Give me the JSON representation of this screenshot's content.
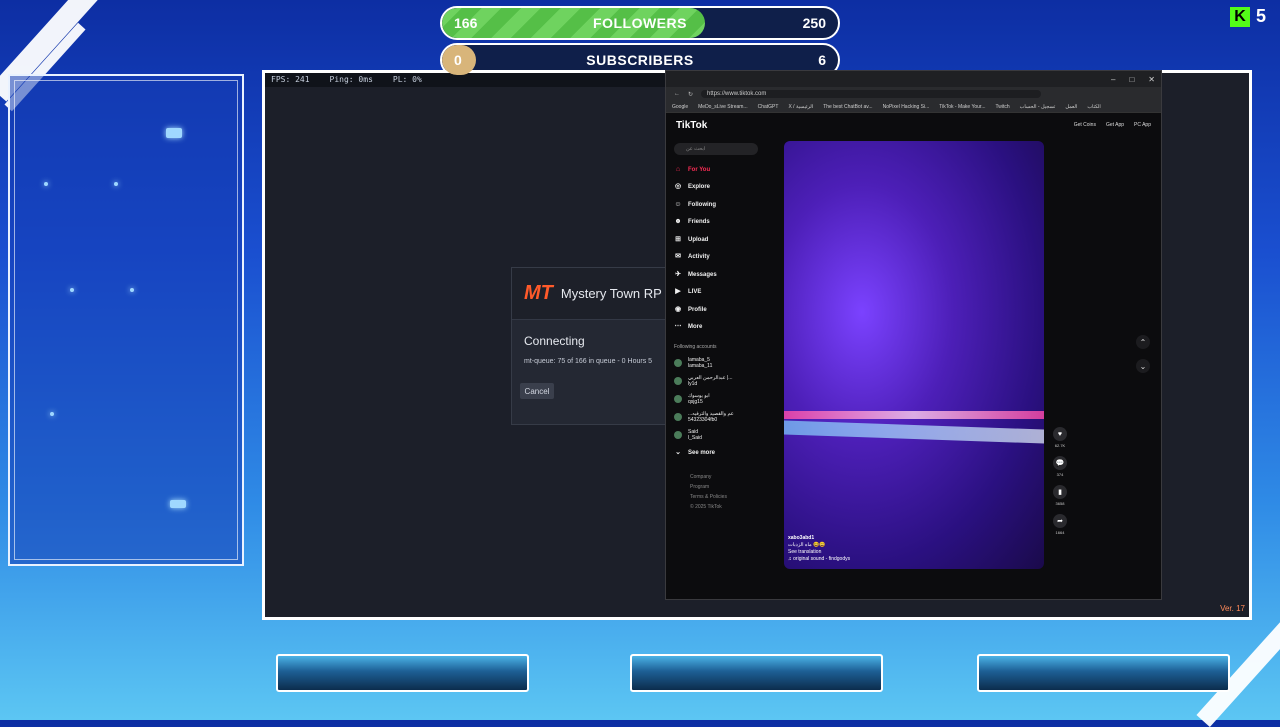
{
  "overlay": {
    "followers": {
      "label": "FOLLOWERS",
      "current": "166",
      "goal": "250",
      "progress": 0.664
    },
    "subscribers": {
      "label": "SUBSCRIBERS",
      "current": "0",
      "goal": "6",
      "progress": 0.0
    },
    "kick": {
      "icon": "kick-logo",
      "viewer_count": "5"
    }
  },
  "game": {
    "perf": {
      "fps": "FPS: 241",
      "ping": "Ping: 0ms",
      "pl": "PL: 0%"
    },
    "dialog": {
      "logo": "MT",
      "server_name": "Mystery Town RP",
      "status": "Connecting",
      "queue": "mt-queue: 75 of 166 in queue - 0 Hours 5",
      "cancel_label": "Cancel"
    },
    "version": "Ver. 17"
  },
  "browser": {
    "window_controls": [
      "–",
      "□",
      "✕"
    ],
    "url": "https://www.tiktok.com",
    "bookmarks": [
      "Google",
      "MeDo_sLive Stream...",
      "ChatGPT",
      "X / الرئيسية",
      "The best ChatBot av...",
      "NoPixel Hacking Si...",
      "TikTok - Make Your...",
      "Twitch",
      "تسجيل - الحساب",
      "العمل",
      "الكتاب"
    ],
    "tiktok": {
      "logo": "TikTok",
      "actions": [
        "Get Coins",
        "Get App",
        "PC App"
      ],
      "search_placeholder": "ابحث عن",
      "nav": [
        {
          "label": "For You",
          "icon": "home-icon"
        },
        {
          "label": "Explore",
          "icon": "compass-icon"
        },
        {
          "label": "Following",
          "icon": "user-follow-icon"
        },
        {
          "label": "Friends",
          "icon": "friends-icon"
        },
        {
          "label": "Upload",
          "icon": "upload-icon"
        },
        {
          "label": "Activity",
          "icon": "activity-icon"
        },
        {
          "label": "Messages",
          "icon": "messages-icon"
        },
        {
          "label": "LIVE",
          "icon": "live-icon"
        },
        {
          "label": "Profile",
          "icon": "profile-icon"
        },
        {
          "label": "More",
          "icon": "more-icon"
        }
      ],
      "following_label": "Following accounts",
      "accounts": [
        {
          "name": "lamaba_5",
          "handle": "lamaba_11"
        },
        {
          "name": "عبدالرحمن العربي |...",
          "handle": "ly1d"
        },
        {
          "name": "ابو يوسوك",
          "handle": "qsjg15"
        },
        {
          "name": "...عم والقصيد والترفيه",
          "handle": "54323304fb0"
        },
        {
          "name": "Said",
          "handle": "l_Said"
        }
      ],
      "see_more": "See more",
      "footer": [
        "Company",
        "Program",
        "Terms & Policies",
        "© 2025 TikTok"
      ],
      "video": {
        "username": "xabo3abd1",
        "caption": "ماه الزدبات 😆😄",
        "see_translation": "See translation",
        "sound": "♫ original sound - findgodys"
      },
      "counts": {
        "likes": "62.7K",
        "comments": "374",
        "saves": "3658",
        "shares": "1664"
      }
    }
  }
}
